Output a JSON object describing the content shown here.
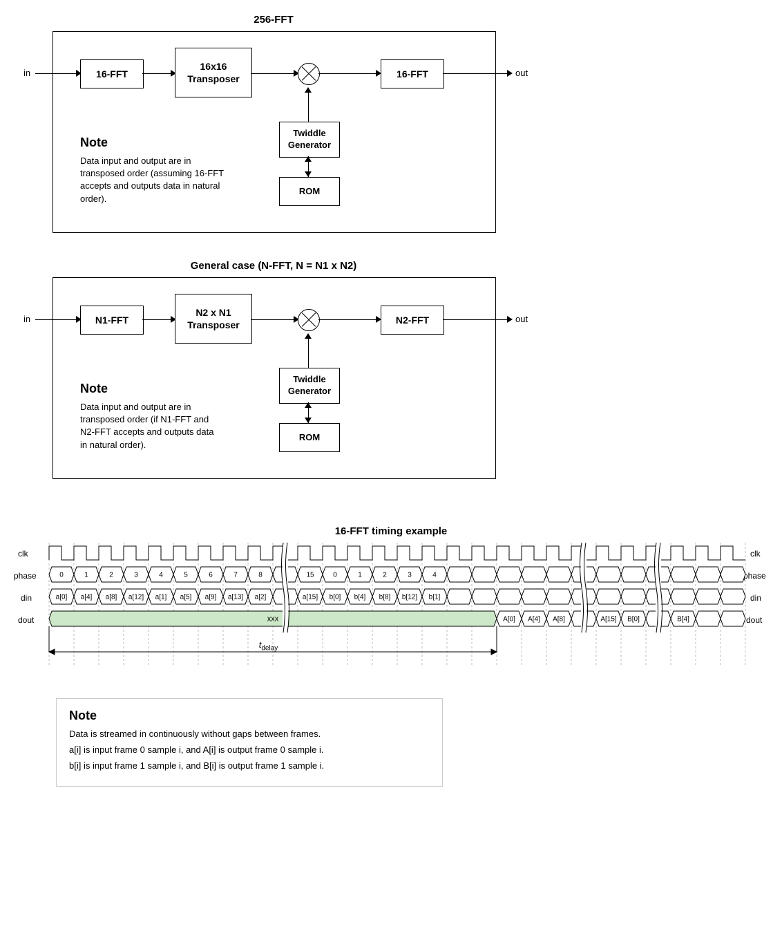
{
  "diagram1": {
    "title": "256-FFT",
    "in": "in",
    "out": "out",
    "fft1": "16-FFT",
    "transposer": "16x16\nTransposer",
    "twiddle": "Twiddle\nGenerator",
    "rom": "ROM",
    "fft2": "16-FFT",
    "note_title": "Note",
    "note_body": "Data input and output are in transposed order (assuming 16-FFT accepts and outputs data in natural order)."
  },
  "diagram2": {
    "title": "General case (N-FFT, N = N1 x N2)",
    "in": "in",
    "out": "out",
    "fft1": "N1-FFT",
    "transposer": "N2 x N1\nTransposer",
    "twiddle": "Twiddle\nGenerator",
    "rom": "ROM",
    "fft2": "N2-FFT",
    "note_title": "Note",
    "note_body": "Data input and output are in transposed order (if N1-FFT and N2-FFT accepts and outputs data in natural order)."
  },
  "timing": {
    "title": "16-FFT timing example",
    "clk": "clk",
    "phase": "phase",
    "din": "din",
    "dout": "dout",
    "xxx": "xxx",
    "tdelay": "t",
    "tdelay_sub": "delay",
    "phase_seg1": [
      "0",
      "1",
      "2",
      "3",
      "4",
      "5",
      "6",
      "7",
      "8"
    ],
    "phase_seg2": [
      "15",
      "0",
      "1",
      "2",
      "3",
      "4"
    ],
    "din_seg1": [
      "a[0]",
      "a[4]",
      "a[8]",
      "a[12]",
      "a[1]",
      "a[5]",
      "a[9]",
      "a[13]",
      "a[2]"
    ],
    "din_seg2": [
      "a[15]",
      "b[0]",
      "b[4]",
      "b[8]",
      "b[12]",
      "b[1]"
    ],
    "dout_seg1": [
      "A[0]",
      "A[4]",
      "A[8]"
    ],
    "dout_seg2": [
      "A[15]",
      "B[0]"
    ],
    "dout_seg3": [
      "B[4]"
    ],
    "note_title": "Note",
    "note_line1": "Data is streamed in continuously without gaps between frames.",
    "note_line2": "a[i] is input frame 0 sample i, and A[i] is output frame 0 sample i.",
    "note_line3": "b[i] is input frame 1 sample i, and B[i] is output frame 1 sample i."
  }
}
